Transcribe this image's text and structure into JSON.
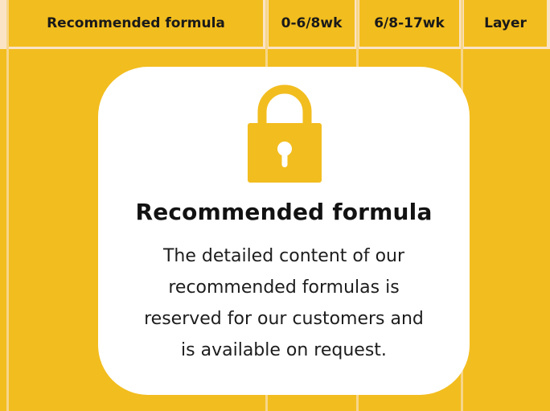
{
  "table": {
    "columns": [
      {
        "label": "Recommended formula"
      },
      {
        "label": "0-6/8wk"
      },
      {
        "label": "6/8-17wk"
      },
      {
        "label": "Layer"
      }
    ]
  },
  "locked_panel": {
    "icon": "padlock-icon",
    "title": "Recommended formula",
    "lines": [
      "The detailed content of our",
      "recommended formulas is",
      "reserved for our customers and",
      "is available on request."
    ]
  },
  "colors": {
    "accent": "#f2bd1e",
    "header_border": "#fbe3c6",
    "card": "#ffffff"
  }
}
